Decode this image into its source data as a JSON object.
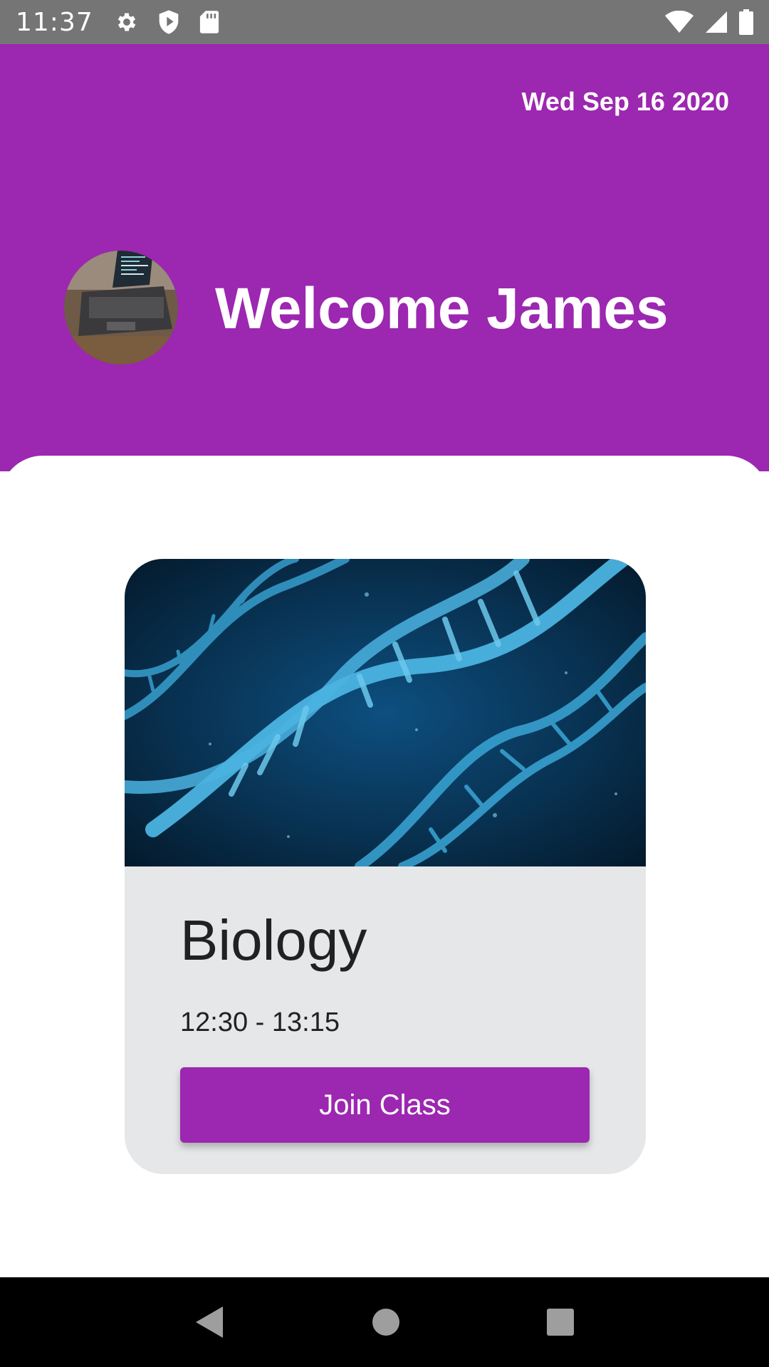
{
  "status_bar": {
    "time": "11:37",
    "left_icons": [
      "gear-icon",
      "shield-icon",
      "sd-card-icon"
    ],
    "right_icons": [
      "wifi-icon",
      "cell-signal-icon",
      "battery-icon"
    ]
  },
  "header": {
    "date": "Wed Sep 16 2020",
    "welcome_text": "Welcome James",
    "background_color": "#9c27b0"
  },
  "class_card": {
    "title": "Biology",
    "time": "12:30 - 13:15",
    "join_label": "Join Class",
    "image_subject": "dna-helix",
    "background_color": "#e6e7e9",
    "button_color": "#9c27b0"
  },
  "nav_bar": {
    "buttons": [
      "back-icon",
      "home-icon",
      "recents-icon"
    ]
  }
}
